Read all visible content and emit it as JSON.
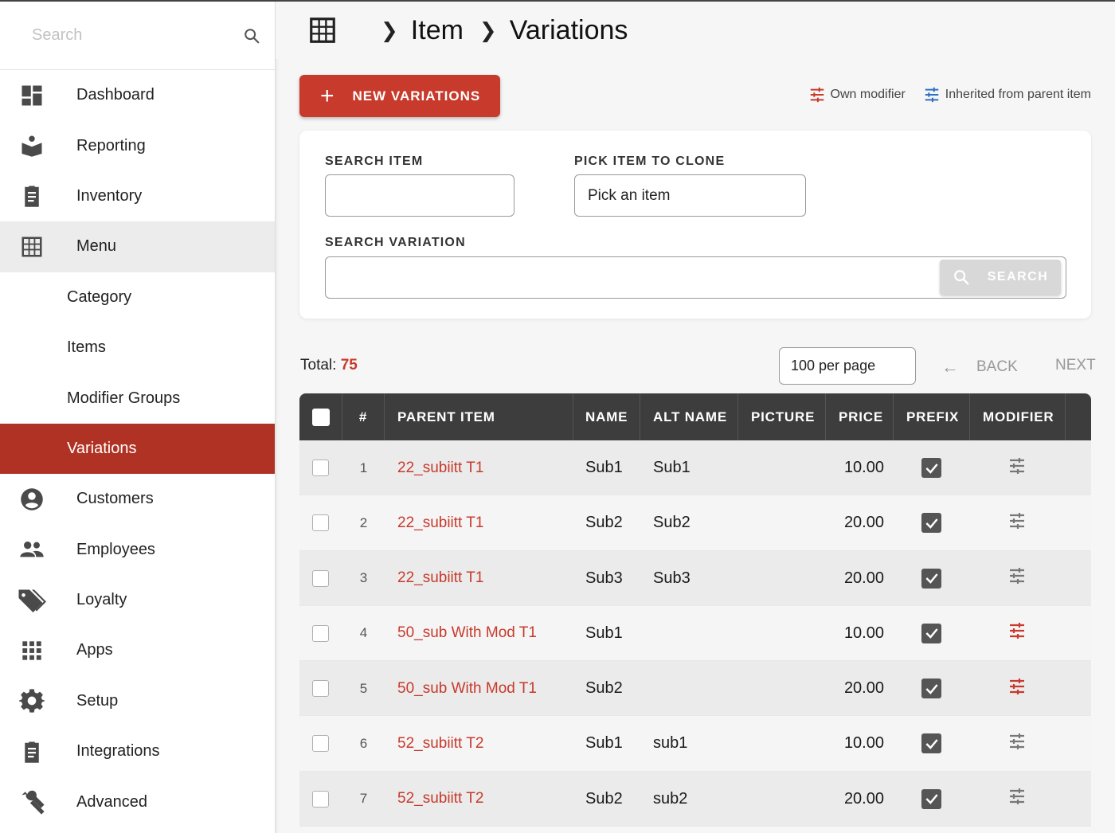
{
  "sidebar": {
    "search_placeholder": "Search",
    "items": [
      {
        "label": "Dashboard",
        "icon": "dashboard-icon"
      },
      {
        "label": "Reporting",
        "icon": "reporting-icon"
      },
      {
        "label": "Inventory",
        "icon": "inventory-icon"
      },
      {
        "label": "Menu",
        "icon": "menu-grid-icon"
      },
      {
        "label": "Category"
      },
      {
        "label": "Items"
      },
      {
        "label": "Modifier Groups"
      },
      {
        "label": "Variations"
      },
      {
        "label": "Customers",
        "icon": "customer-icon"
      },
      {
        "label": "Employees",
        "icon": "employees-icon"
      },
      {
        "label": "Loyalty",
        "icon": "loyalty-tag-icon"
      },
      {
        "label": "Apps",
        "icon": "apps-icon"
      },
      {
        "label": "Setup",
        "icon": "gear-icon"
      },
      {
        "label": "Integrations",
        "icon": "integrations-icon"
      },
      {
        "label": "Advanced",
        "icon": "wrench-icon"
      }
    ]
  },
  "header": {
    "crumb1": "Item",
    "crumb2": "Variations"
  },
  "toolbar": {
    "new_label": "NEW VARIATIONS",
    "legend_own": "Own modifier",
    "legend_inherited": "Inherited from parent item",
    "own_color": "#c73a2c",
    "inherited_color": "#2f6fc4"
  },
  "filters": {
    "search_item_label": "SEARCH ITEM",
    "search_item_value": "",
    "pick_clone_label": "PICK ITEM TO CLONE",
    "pick_clone_value": "Pick an item",
    "search_variation_label": "SEARCH VARIATION",
    "search_variation_value": "",
    "search_button": "SEARCH"
  },
  "pagination": {
    "total_label": "Total:",
    "total_value": "75",
    "per_page": "100 per page",
    "back": "BACK",
    "next": "NEXT"
  },
  "table": {
    "columns": [
      "#",
      "PARENT ITEM",
      "NAME",
      "ALT NAME",
      "PICTURE",
      "PRICE",
      "PREFIX",
      "MODIFIER"
    ],
    "rows": [
      {
        "num": "1",
        "parent": "22_subiitt T1",
        "name": "Sub1",
        "alt": "Sub1",
        "price": "10.00",
        "prefix": true,
        "modifier": "inherited"
      },
      {
        "num": "2",
        "parent": "22_subiitt T1",
        "name": "Sub2",
        "alt": "Sub2",
        "price": "20.00",
        "prefix": true,
        "modifier": "inherited"
      },
      {
        "num": "3",
        "parent": "22_subiitt T1",
        "name": "Sub3",
        "alt": "Sub3",
        "price": "20.00",
        "prefix": true,
        "modifier": "inherited"
      },
      {
        "num": "4",
        "parent": "50_sub With Mod T1",
        "name": "Sub1",
        "alt": "",
        "price": "10.00",
        "prefix": true,
        "modifier": "own"
      },
      {
        "num": "5",
        "parent": "50_sub With Mod T1",
        "name": "Sub2",
        "alt": "",
        "price": "20.00",
        "prefix": true,
        "modifier": "own"
      },
      {
        "num": "6",
        "parent": "52_subiitt T2",
        "name": "Sub1",
        "alt": "sub1",
        "price": "10.00",
        "prefix": true,
        "modifier": "inherited"
      },
      {
        "num": "7",
        "parent": "52_subiitt T2",
        "name": "Sub2",
        "alt": "sub2",
        "price": "20.00",
        "prefix": true,
        "modifier": "inherited"
      }
    ]
  }
}
